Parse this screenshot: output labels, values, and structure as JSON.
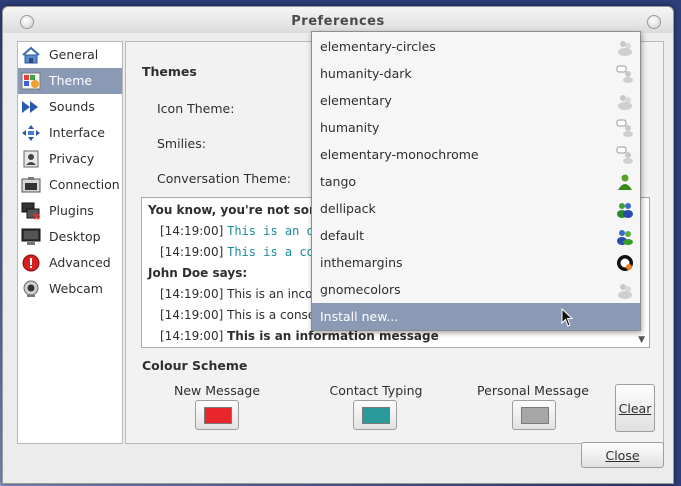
{
  "window": {
    "title": "Preferences"
  },
  "sidebar": {
    "items": [
      {
        "label": "General",
        "icon": "home-icon"
      },
      {
        "label": "Theme",
        "icon": "theme-icon",
        "active": true
      },
      {
        "label": "Sounds",
        "icon": "sounds-icon"
      },
      {
        "label": "Interface",
        "icon": "interface-icon"
      },
      {
        "label": "Privacy",
        "icon": "privacy-icon"
      },
      {
        "label": "Connection",
        "icon": "connection-icon"
      },
      {
        "label": "Plugins",
        "icon": "plugins-icon"
      },
      {
        "label": "Desktop",
        "icon": "desktop-icon"
      },
      {
        "label": "Advanced",
        "icon": "advanced-icon"
      },
      {
        "label": "Webcam",
        "icon": "webcam-icon"
      }
    ]
  },
  "themes": {
    "title": "Themes",
    "icon_theme_label": "Icon Theme:",
    "smilies_label": "Smilies:",
    "conversation_label": "Conversation Theme:"
  },
  "preview": {
    "line0": "You know, you're not some",
    "line1_time": "[14:19:00]",
    "line1_text": "This is an o",
    "line2_time": "[14:19:00]",
    "line2_text": "This is a co",
    "line3": "John Doe says:",
    "line4_time": "[14:19:00]",
    "line4_text": "This is an incom",
    "line5_time": "[14:19:00]",
    "line5_text": "This is a consecu",
    "line6_time": "[14:19:00]",
    "line6_text": "This is an information message"
  },
  "colour_scheme": {
    "title": "Colour Scheme",
    "new_message_label": "New Message",
    "new_message_color": "#e8262b",
    "contact_typing_label": "Contact Typing",
    "contact_typing_color": "#2a9a9a",
    "personal_message_label": "Personal Message",
    "personal_message_color": "#a6a6a6",
    "clear_label": "Clear"
  },
  "footer": {
    "close_label": "Close"
  },
  "dropdown": {
    "items": [
      {
        "label": "elementary-circles",
        "icon": "gray-buddies-icon"
      },
      {
        "label": "humanity-dark",
        "icon": "gray-chat-buddy-icon"
      },
      {
        "label": "elementary",
        "icon": "gray-buddies-icon"
      },
      {
        "label": "humanity",
        "icon": "gray-chat-buddy-icon"
      },
      {
        "label": "elementary-monochrome",
        "icon": "gray-chat-buddy-icon"
      },
      {
        "label": "tango",
        "icon": "green-person-icon"
      },
      {
        "label": "dellipack",
        "icon": "green-blue-buddies-icon"
      },
      {
        "label": "default",
        "icon": "green-blue-buddies-icon"
      },
      {
        "label": "inthemargins",
        "icon": "orange-ring-icon"
      },
      {
        "label": "gnomecolors",
        "icon": "gray-buddies-icon"
      },
      {
        "label": "Install new...",
        "icon": "",
        "hover": true
      }
    ]
  }
}
